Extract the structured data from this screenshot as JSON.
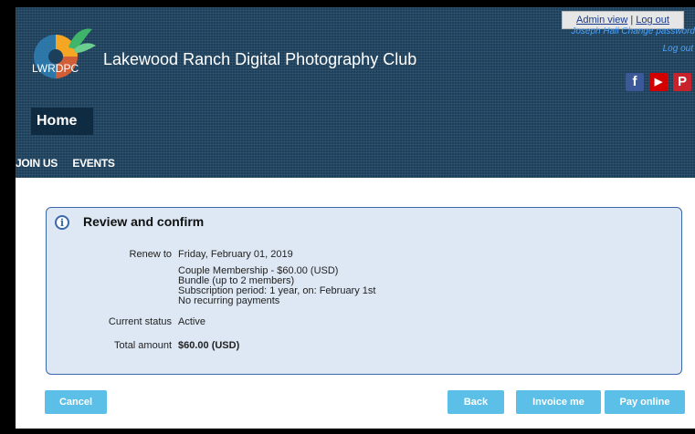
{
  "header": {
    "admin_view": "Admin view",
    "sep": "|",
    "log_out": "Log out",
    "user_links": "Joseph Hall   Change password",
    "log_out_italic": "Log out",
    "logo_text": "LWRDPC",
    "site_title": "Lakewood Ranch Digital Photography Club",
    "social": {
      "facebook": "f",
      "youtube": "▶",
      "pinterest": "P"
    }
  },
  "page": {
    "home": "Home"
  },
  "nav": {
    "items": [
      "JOIN US",
      "EVENTS"
    ]
  },
  "panel": {
    "title": "Review and confirm",
    "renew_label": "Renew to",
    "renew_value": "Friday, February 01, 2019",
    "membership_lines": [
      "Couple Membership - $60.00 (USD)",
      "Bundle (up to 2 members)",
      "Subscription period: 1 year, on: February 1st",
      "No recurring payments"
    ],
    "status_label": "Current status",
    "status_value": "Active",
    "total_label": "Total amount",
    "total_value": "$60.00 (USD)"
  },
  "buttons": {
    "cancel": "Cancel",
    "back": "Back",
    "invoice": "Invoice me",
    "pay": "Pay online"
  },
  "colors": {
    "header_bg": "#1c3f5b",
    "button": "#5bbfe7",
    "panel_bg": "#dde8f4",
    "panel_border": "#3a68a8"
  }
}
